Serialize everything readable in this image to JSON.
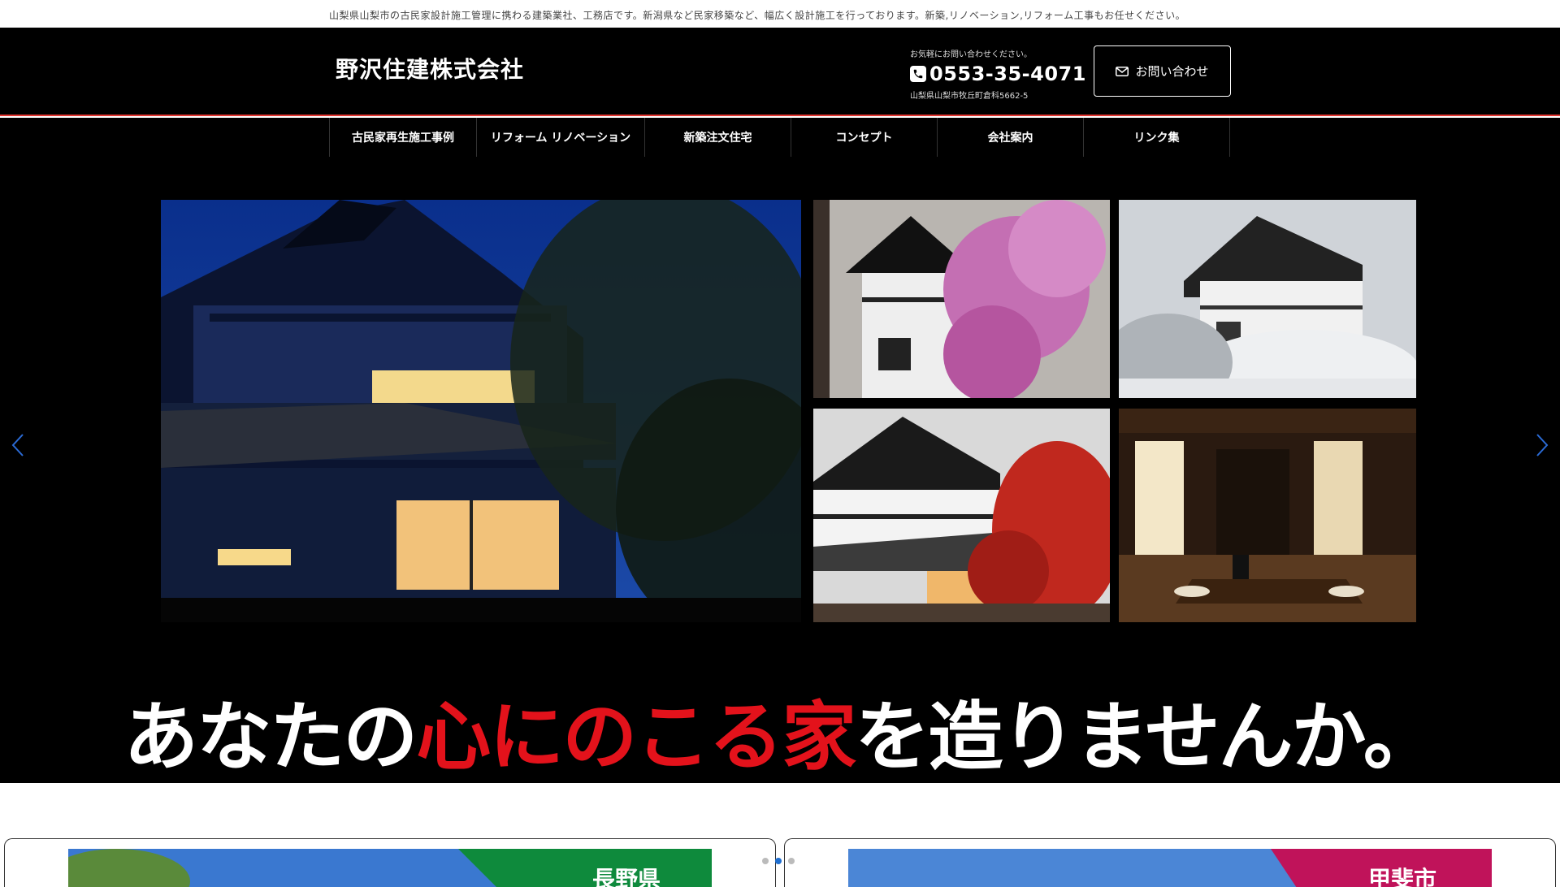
{
  "topbar": {
    "text": "山梨県山梨市の古民家設計施工管理に携わる建築業社、工務店です。新潟県など民家移築など、幅広く設計施工を行っております。新築,リノベーション,リフォーム工事もお任せください。"
  },
  "header": {
    "logo": "野沢住建株式会社",
    "contact_note": "お気軽にお問い合わせください。",
    "phone": "0553-35-4071",
    "address": "山梨県山梨市牧丘町倉科5662-5",
    "contact_button": "お問い合わせ",
    "accent_color": "#e3342f"
  },
  "nav": {
    "items": [
      {
        "label": "古民家再生施工事例"
      },
      {
        "label": "リフォーム リノベーション"
      },
      {
        "label": "新築注文住宅"
      },
      {
        "label": "コンセプト"
      },
      {
        "label": "会社案内"
      },
      {
        "label": "リンク集"
      }
    ]
  },
  "hero": {
    "tagline_part1": "あなたの",
    "tagline_part2": "心にのこる家",
    "tagline_part3": "を造りませんか。",
    "tagline_accent": "#e3121b"
  },
  "cards": {
    "left_label": "長野県",
    "right_label": "甲斐市",
    "active_dot": 1
  }
}
